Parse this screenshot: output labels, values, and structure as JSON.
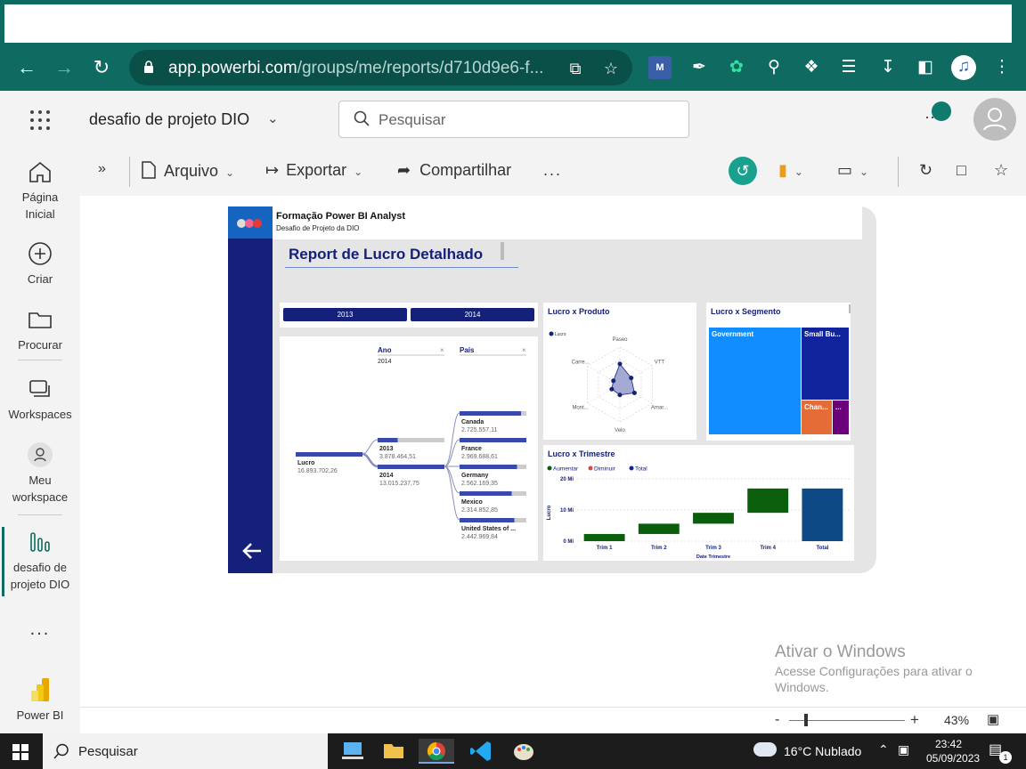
{
  "browser": {
    "url_host": "app.powerbi.com",
    "url_path": "/groups/me/reports/d710d9e6-f..."
  },
  "header": {
    "workspace_title": "desafio de projeto DIO",
    "search_placeholder": "Pesquisar"
  },
  "rail": {
    "items": [
      {
        "label1": "Página",
        "label2": "Inicial"
      },
      {
        "label1": "Criar",
        "label2": ""
      },
      {
        "label1": "Procurar",
        "label2": ""
      },
      {
        "label1": "Workspaces",
        "label2": ""
      },
      {
        "label1": "Meu",
        "label2": "workspace"
      },
      {
        "label1": "desafio de",
        "label2": "projeto DIO"
      },
      {
        "label1": "Power BI",
        "label2": ""
      }
    ],
    "more": "..."
  },
  "toolbar": {
    "arquivo": "Arquivo",
    "exportar": "Exportar",
    "compartilhar": "Compartilhar",
    "more": "..."
  },
  "report": {
    "header_title": "Formação Power BI Analyst",
    "header_subtitle": "Desafio de Projeto da DIO",
    "title": "Report de Lucro Detalhado",
    "year_buttons": [
      "2013",
      "2014"
    ],
    "decomp": {
      "filter_ano_label": "Ano",
      "filter_ano_value": "2014",
      "filter_pais_label": "País",
      "root_label": "Lucro",
      "root_value": "16.893.702,26",
      "years": [
        {
          "label": "2013",
          "value": "3.878.464,51",
          "fill": 0.3
        },
        {
          "label": "2014",
          "value": "13.015.237,75",
          "fill": 1.0
        }
      ],
      "countries": [
        {
          "label": "Canada",
          "value": "2.725.557,11",
          "fill": 0.92
        },
        {
          "label": "France",
          "value": "2.969.688,61",
          "fill": 1.0
        },
        {
          "label": "Germany",
          "value": "2.562.169,35",
          "fill": 0.86
        },
        {
          "label": "Mexico",
          "value": "2.314.852,85",
          "fill": 0.78
        },
        {
          "label": "United States of ...",
          "value": "2.442.969,84",
          "fill": 0.82
        }
      ]
    },
    "radar": {
      "title": "Lucro x Produto",
      "legend": "Lucro",
      "axes": [
        "Paseo",
        "VTT",
        "Amar...",
        "Velo",
        "Mont...",
        "Carre..."
      ],
      "values": [
        0.55,
        0.35,
        0.45,
        0.28,
        0.25,
        0.2
      ]
    },
    "treemap": {
      "title": "Lucro x Segmento",
      "segments": [
        "Government",
        "Small Bu...",
        "Chan...",
        "..."
      ],
      "colors": [
        "#118dff",
        "#12239e",
        "#e66c37",
        "#6b007b"
      ]
    },
    "waterfall": {
      "title": "Lucro x Trimestre",
      "legend": [
        "Aumentar",
        "Diminuir",
        "Total"
      ],
      "legend_colors": [
        "#0b5e0b",
        "#d64550",
        "#12239e"
      ],
      "y_ticks": [
        "20 Mi",
        "10 Mi",
        "0 Mi"
      ],
      "ylabel": "Lucro",
      "xlabel": "Date Trimestre"
    }
  },
  "chart_data": {
    "type": "bar",
    "title": "Lucro x Trimestre",
    "categories": [
      "Trim 1",
      "Trim 2",
      "Trim 3",
      "Trim 4",
      "Total"
    ],
    "series": [
      {
        "name": "Aumentar",
        "values": [
          2.3,
          3.3,
          3.5,
          7.8,
          0
        ]
      },
      {
        "name": "Total",
        "values": [
          0,
          0,
          0,
          0,
          16.9
        ]
      }
    ],
    "ylim": [
      0,
      20
    ],
    "xlabel": "Date Trimestre",
    "ylabel": "Lucro"
  },
  "zoom": {
    "minus": "-",
    "plus": "+",
    "value": "43%"
  },
  "watermark": {
    "line1": "Ativar o Windows",
    "line2": "Acesse Configurações para ativar o",
    "line3": "Windows."
  },
  "taskbar": {
    "search": "Pesquisar",
    "weather": "16°C  Nublado",
    "time": "23:42",
    "date": "05/09/2023",
    "notif": "1"
  }
}
